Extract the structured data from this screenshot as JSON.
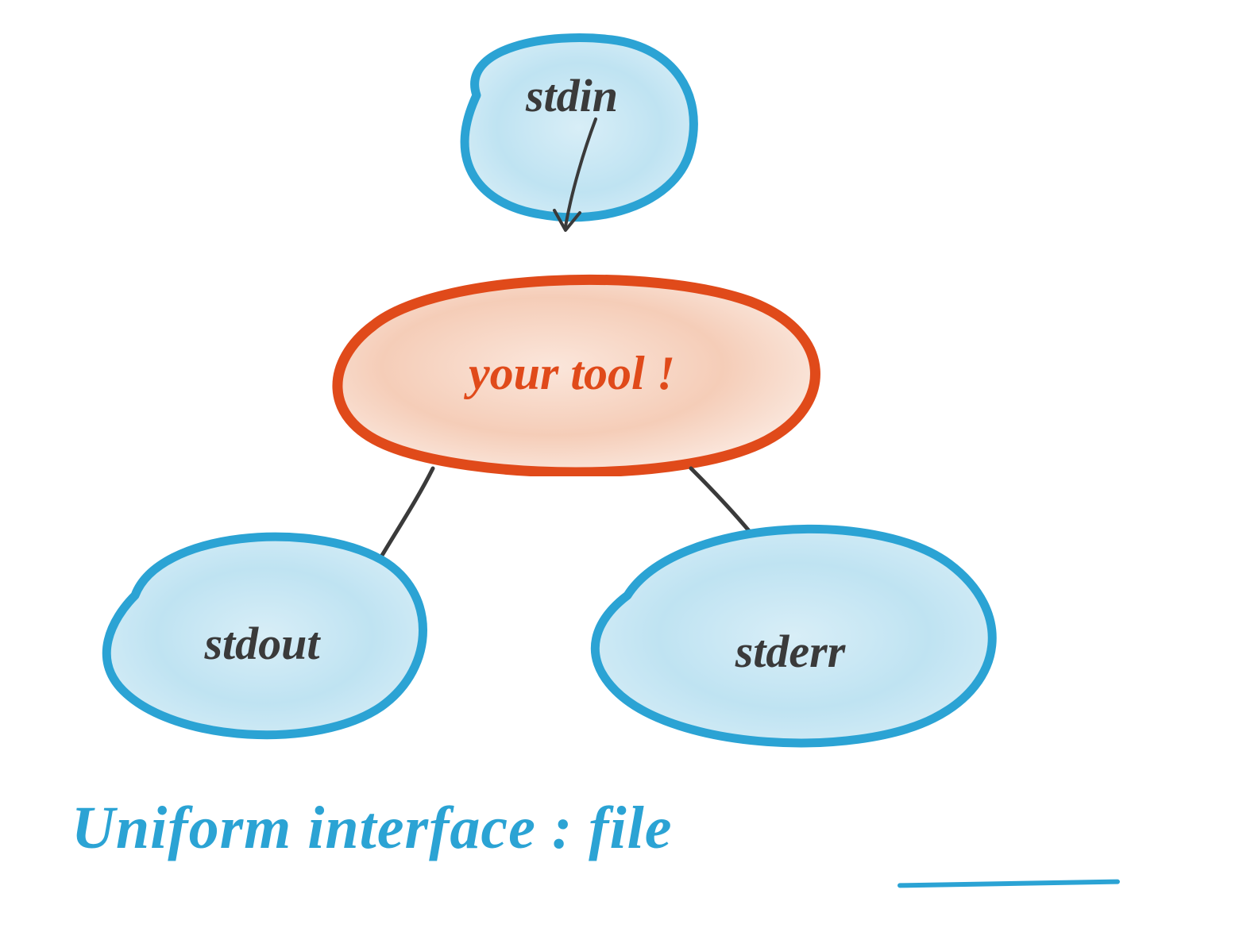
{
  "nodes": {
    "stdin": {
      "label": "stdin"
    },
    "yourtool": {
      "label": "your tool !"
    },
    "stdout": {
      "label": "stdout"
    },
    "stderr": {
      "label": "stderr"
    }
  },
  "caption": {
    "prefix": "Uniform interface :",
    "emphasis": "file"
  },
  "colors": {
    "blue": "#2ba3d4",
    "orange": "#e04a1a",
    "text": "#3a3a3a",
    "blueFill": "#bfe3f2",
    "orangeFill": "#f5cdb8"
  }
}
